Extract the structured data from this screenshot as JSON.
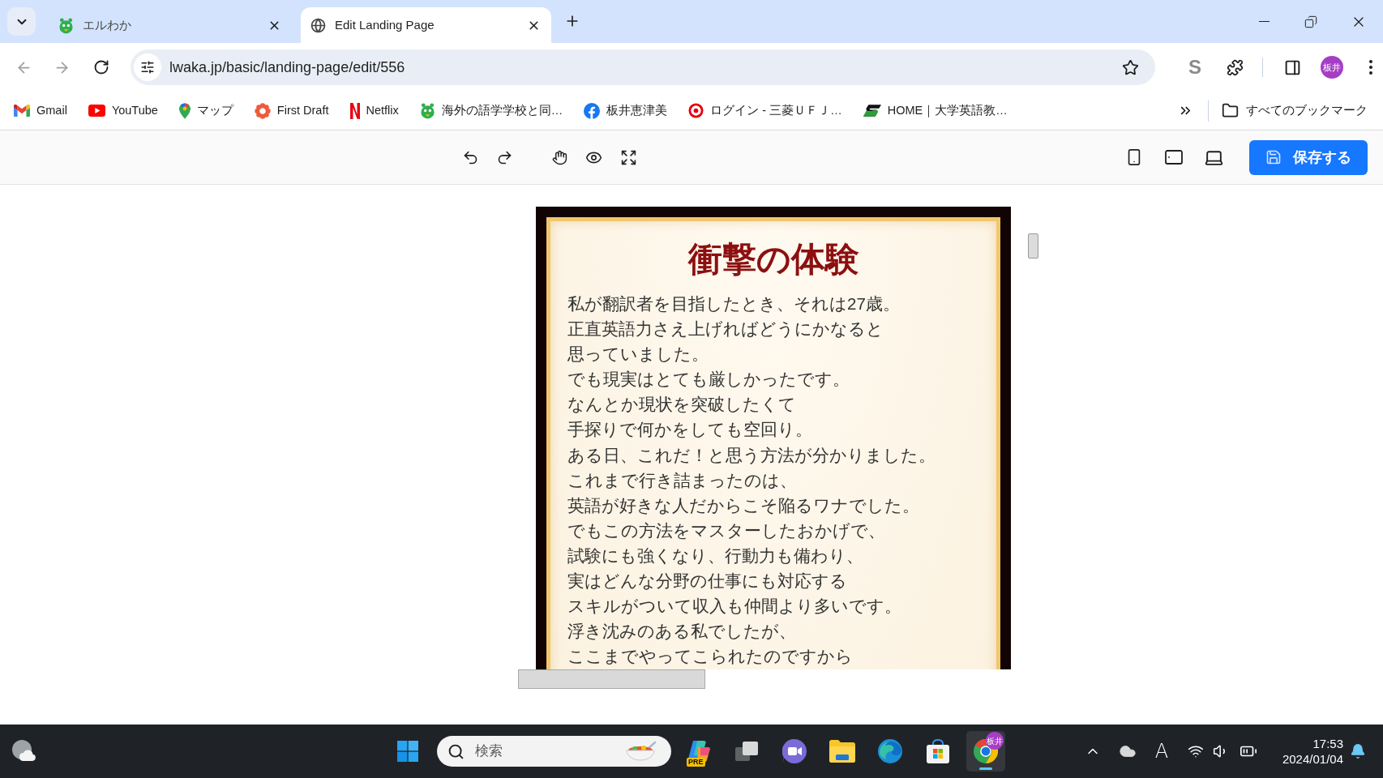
{
  "tab_strip": {
    "tabs": [
      {
        "title": "エルわか",
        "selected": false
      },
      {
        "title": "Edit Landing Page",
        "selected": true
      }
    ]
  },
  "toolbar": {
    "url": "lwaka.jp/basic/landing-page/edit/556",
    "extension_letter": "S",
    "profile_initials": "板井"
  },
  "bookmarks_bar": {
    "bookmarks": [
      {
        "label": "Gmail"
      },
      {
        "label": "YouTube"
      },
      {
        "label": "マップ"
      },
      {
        "label": "First Draft"
      },
      {
        "label": "Netflix"
      },
      {
        "label": "海外の語学学校と同…"
      },
      {
        "label": "板井恵津美"
      },
      {
        "label": "ログイン - 三菱ＵＦＪ…"
      },
      {
        "label": "HOME｜大学英語教…"
      }
    ],
    "all_bookmarks": "すべてのブックマーク"
  },
  "editor_toolbar": {
    "save_button": "保存する"
  },
  "section": {
    "title": "衝撃の体験",
    "lines": [
      "私が翻訳者を目指したとき、それは27歳。",
      "正直英語力さえ上げればどうにかなると",
      "思っていました。",
      "でも現実はとても厳しかったです。",
      "なんとか現状を突破したくて",
      "手探りで何かをしても空回り。",
      "ある日、これだ！と思う方法が分かりました。",
      "これまで行き詰まったのは、",
      "英語が好きな人だからこそ陥るワナでした。",
      "でもこの方法をマスターしたおかげで、",
      "試験にも強くなり、行動力も備わり、",
      "実はどんな分野の仕事にも対応する",
      "スキルがついて収入も仲間より多いです。",
      "浮き沈みのある私でしたが、",
      "ここまでやってこられたのですから"
    ]
  },
  "taskbar": {
    "search": {
      "placeholder": "検索"
    },
    "apps": [
      {
        "selected": false,
        "badge": "PRE"
      },
      {
        "selected": false
      },
      {
        "selected": false
      },
      {
        "selected": false
      },
      {
        "selected": false
      },
      {
        "selected": false
      },
      {
        "selected": true,
        "badge": "板井"
      }
    ],
    "ime": "A",
    "clock": {
      "time": "17:53",
      "date": "2024/01/04"
    }
  }
}
